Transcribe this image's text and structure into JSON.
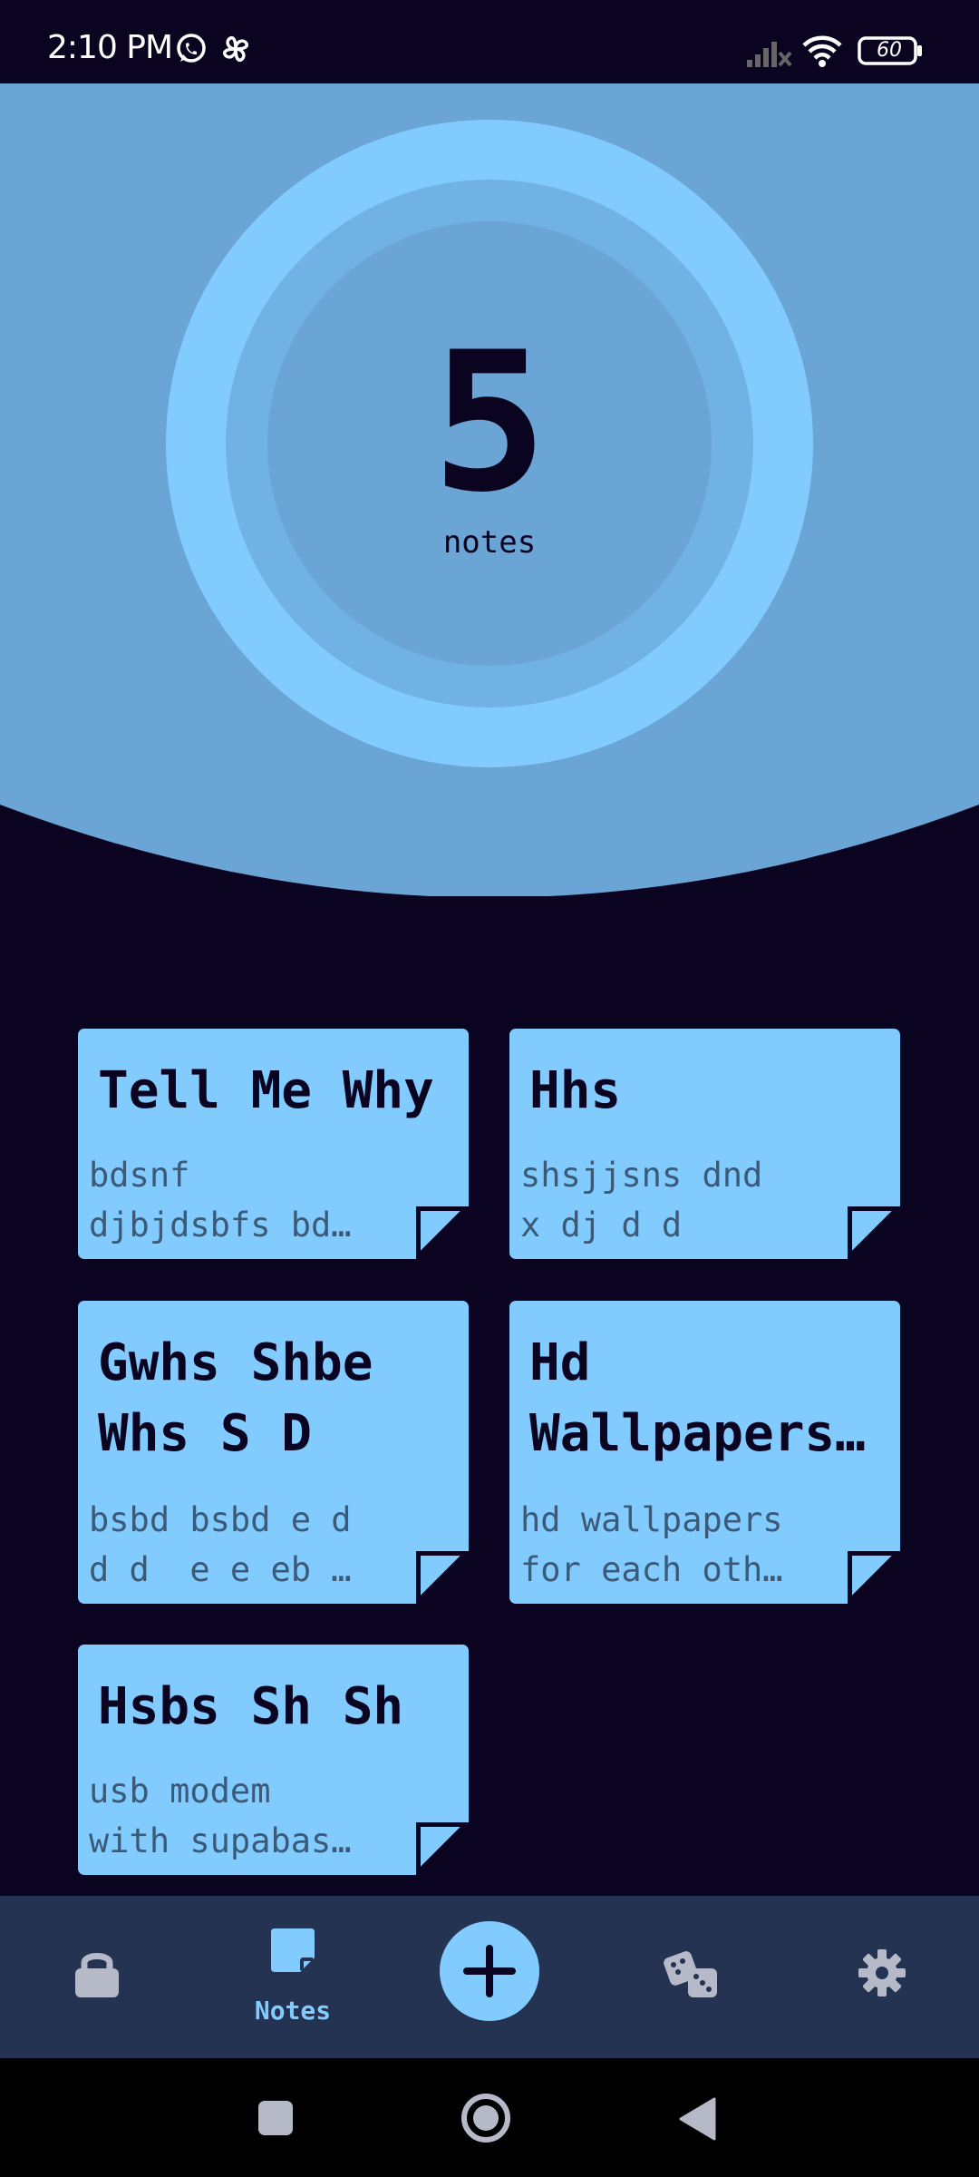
{
  "status_bar": {
    "time": "2:10 PM",
    "notification_icons": [
      "whatsapp-icon",
      "pinwheel-icon"
    ],
    "battery": "60",
    "system_icons": [
      "signal-icon",
      "wifi-icon",
      "battery-icon"
    ]
  },
  "header": {
    "count": "5",
    "count_label": "notes"
  },
  "notes": [
    {
      "title": "Tell Me Why",
      "body": "bdsnf\ndjbjdsbfs bd…"
    },
    {
      "title": "Hhs",
      "body": "shsjjsns dnd\nx dj d d"
    },
    {
      "title": "Gwhs Shbe\nWhs S D",
      "body": "bsbd bsbd e d\nd d  e e eb …"
    },
    {
      "title": "Hd\nWallpapers…",
      "body": "hd wallpapers\nfor each oth…"
    },
    {
      "title": "Hsbs Sh Sh",
      "body": "usb modem\nwith supabas…"
    }
  ],
  "bottom_nav": {
    "items": [
      {
        "icon": "lock-icon",
        "label": ""
      },
      {
        "icon": "note-icon",
        "label": "Notes"
      },
      {
        "icon": "plus-icon",
        "label": ""
      },
      {
        "icon": "dice-icon",
        "label": ""
      },
      {
        "icon": "gear-icon",
        "label": ""
      }
    ],
    "active_label": "Notes"
  },
  "colors": {
    "background": "#0a0420",
    "header": "#6aa5d6",
    "accent": "#82cbff",
    "navbar": "#243352"
  }
}
